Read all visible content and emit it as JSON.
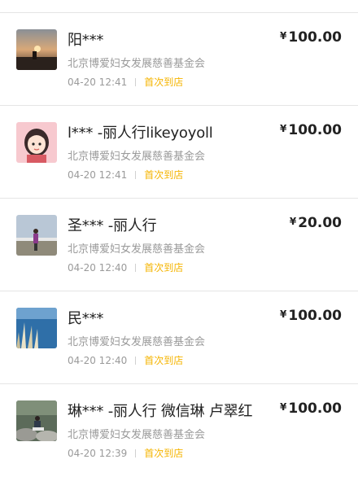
{
  "donations": [
    {
      "name": "阳***",
      "org": "北京博爱妇女发展慈善基金会",
      "time": "04-20 12:41",
      "tag": "首次到店",
      "currency": "¥",
      "amount": "100.00",
      "avatar": "sunset-photo-avatar"
    },
    {
      "name": "l*** -丽人行likeyoyoll",
      "org": "北京博爱妇女发展慈善基金会",
      "time": "04-20 12:41",
      "tag": "首次到店",
      "currency": "¥",
      "amount": "100.00",
      "avatar": "cartoon-girl-avatar"
    },
    {
      "name": "圣*** -丽人行",
      "org": "北京博爱妇女发展慈善基金会",
      "time": "04-20 12:40",
      "tag": "首次到店",
      "currency": "¥",
      "amount": "20.00",
      "avatar": "person-outdoor-avatar"
    },
    {
      "name": "民***",
      "org": "北京博爱妇女发展慈善基金会",
      "time": "04-20 12:40",
      "tag": "首次到店",
      "currency": "¥",
      "amount": "100.00",
      "avatar": "lake-reeds-avatar"
    },
    {
      "name": "琳*** -丽人行 微信琳 卢翠红",
      "org": "北京博爱妇女发展慈善基金会",
      "time": "04-20 12:39",
      "tag": "首次到店",
      "currency": "¥",
      "amount": "100.00",
      "avatar": "person-rocks-avatar"
    }
  ],
  "colors": {
    "accent_tag": "#f5b400",
    "text_primary": "#222222",
    "text_secondary": "#9a9a9a",
    "divider": "#e5e5e5"
  }
}
